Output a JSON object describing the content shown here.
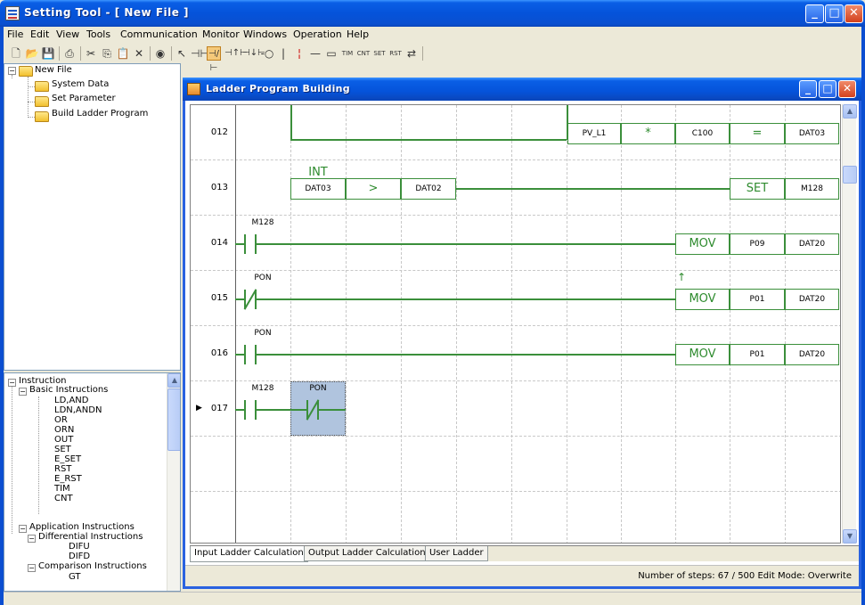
{
  "window": {
    "title": "Setting Tool - [ New File ]"
  },
  "menu": [
    "File",
    "Edit",
    "View",
    "Tools",
    "Communication",
    "Monitor",
    "Windows",
    "Operation",
    "Help"
  ],
  "toolbar": {
    "icons": [
      "new-file-icon",
      "open-folder-icon",
      "save-icon",
      "print-icon",
      "cut-icon",
      "copy-icon",
      "paste-icon",
      "delete-icon",
      "connect-icon",
      "pointer-icon",
      "contact-no-icon",
      "contact-nc-icon",
      "contact-rise-icon",
      "contact-fall-icon",
      "coil-icon",
      "vertical-line-icon",
      "vertical-delete-icon",
      "horizontal-line-icon",
      "function-box-icon",
      "timer-icon",
      "counter-icon",
      "set-icon",
      "reset-icon",
      "instruction-icon"
    ],
    "labels": {
      "tim": "TIM",
      "cnt": "CNT",
      "set": "SET",
      "rst": "RST"
    }
  },
  "tree_top": [
    {
      "label": "New File",
      "level": 0,
      "expanded": true
    },
    {
      "label": "System Data",
      "level": 1
    },
    {
      "label": "Set Parameter",
      "level": 1
    },
    {
      "label": "Build Ladder Program",
      "level": 1
    }
  ],
  "tree_bottom": [
    {
      "label": "Instruction",
      "level": 0,
      "pm": "−"
    },
    {
      "label": "Basic Instructions",
      "level": 1,
      "pm": "−"
    },
    {
      "label": "LD,AND",
      "level": 2
    },
    {
      "label": "LDN,ANDN",
      "level": 2
    },
    {
      "label": "OR",
      "level": 2
    },
    {
      "label": "ORN",
      "level": 2
    },
    {
      "label": "OUT",
      "level": 2
    },
    {
      "label": "SET",
      "level": 2
    },
    {
      "label": "E_SET",
      "level": 2
    },
    {
      "label": "RST",
      "level": 2
    },
    {
      "label": "E_RST",
      "level": 2
    },
    {
      "label": "TIM",
      "level": 2
    },
    {
      "label": "CNT",
      "level": 2
    },
    {
      "label": "Application Instructions",
      "level": 1,
      "pm": "−"
    },
    {
      "label": "Differential Instructions",
      "level": 2,
      "pm": "−"
    },
    {
      "label": "DIFU",
      "level": 3
    },
    {
      "label": "DIFD",
      "level": 3
    },
    {
      "label": "Comparison Instructions",
      "level": 2,
      "pm": "−"
    },
    {
      "label": "GT",
      "level": 3
    }
  ],
  "child": {
    "title": "Ladder Program Building"
  },
  "ladder": {
    "rows": [
      "012",
      "013",
      "014",
      "015",
      "016",
      "017"
    ],
    "current_row_marker": "▶",
    "r012": {
      "a": "PV_L1",
      "op": "*",
      "b": "C100",
      "eq": "=",
      "dst": "DAT03"
    },
    "r013": {
      "int": "INT",
      "a": "DAT03",
      "op": ">",
      "b": "DAT02",
      "set": "SET",
      "dst": "M128"
    },
    "r014": {
      "contact": "M128",
      "fn": "MOV",
      "src": "P09",
      "dst": "DAT20"
    },
    "r015": {
      "contact": "PON",
      "mark": "↑",
      "fn": "MOV",
      "src": "P01",
      "dst": "DAT20"
    },
    "r016": {
      "contact": "PON",
      "fn": "MOV",
      "src": "P01",
      "dst": "DAT20"
    },
    "r017": {
      "contact1": "M128",
      "contact2": "PON"
    }
  },
  "tabs": [
    "Input Ladder Calculation",
    "Output Ladder Calculation",
    "User Ladder"
  ],
  "status": "Number of steps: 67 / 500 Edit Mode: Overwrite"
}
